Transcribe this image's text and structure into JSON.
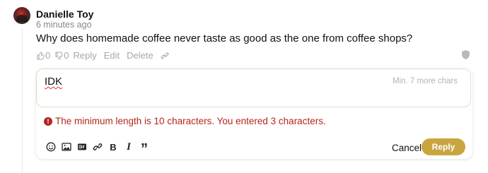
{
  "comment": {
    "author": "Danielle Toy",
    "time": "6 minutes ago",
    "text": "Why does homemade coffee never taste as good as the one from coffee shops?",
    "upvotes": "0",
    "downvotes": "0",
    "reply_label": "Reply",
    "edit_label": "Edit",
    "delete_label": "Delete"
  },
  "editor": {
    "value": "IDK",
    "min_chars_hint": "Min. 7 more chars",
    "error": "The minimum length is 10 characters. You entered 3 characters.",
    "error_icon": "!",
    "bold_glyph": "B",
    "italic_glyph": "I",
    "quote_glyph": "”",
    "cancel_label": "Cancel",
    "reply_label": "Reply",
    "colors": {
      "accent": "#c9a53f",
      "error": "#b3261e"
    },
    "icons": [
      "emoji-icon",
      "image-icon",
      "gif-icon",
      "link-icon",
      "bold-icon",
      "italic-icon",
      "quote-icon"
    ]
  }
}
